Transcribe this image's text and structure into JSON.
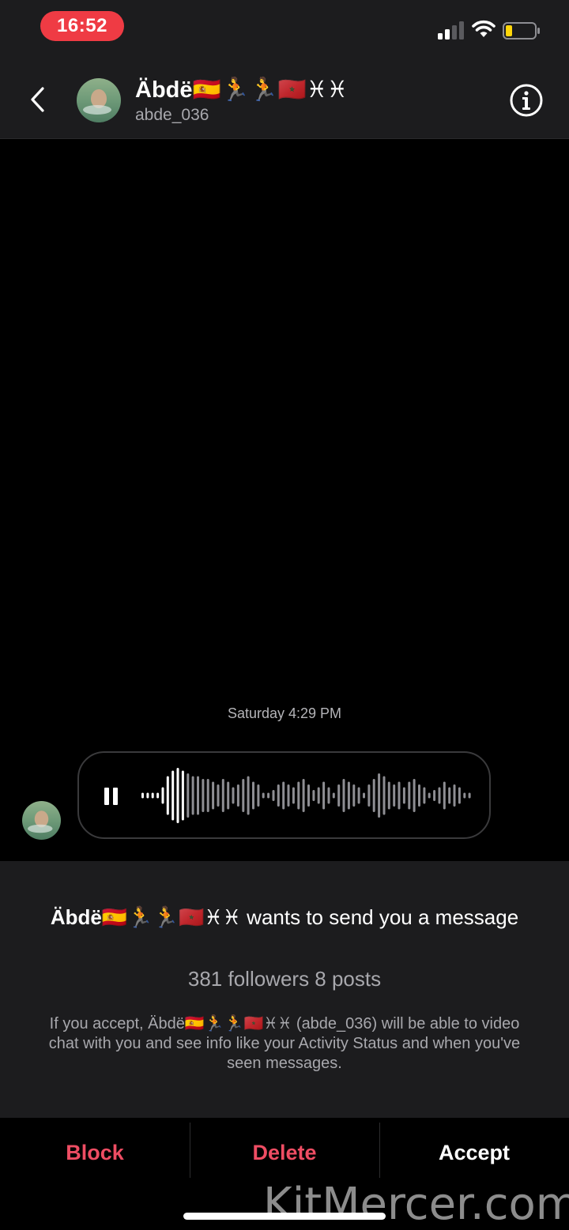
{
  "status_bar": {
    "time": "16:52",
    "time_pill_color": "#ef3b44",
    "signal_icon": "cellular-signal-icon",
    "wifi_icon": "wifi-icon",
    "battery_icon": "battery-low-icon",
    "battery_color": "#ffd60a"
  },
  "header": {
    "back_icon": "chevron-left-icon",
    "display_name": "Äbdë🇪🇸🏃🏃🇲🇦♓♓",
    "username": "abde_036",
    "info_icon": "info-icon"
  },
  "chat": {
    "timestamp": "Saturday 4:29 PM",
    "voice_message": {
      "state": "playing",
      "control_icon": "pause-icon",
      "progress": 0.07
    }
  },
  "request": {
    "sender_name": "Äbdë🇪🇸🏃🏃🇲🇦♓♓",
    "title_suffix": " wants to send you a message",
    "stats": "381 followers 8 posts",
    "note": "If you accept, Äbdë🇪🇸🏃🏃🇲🇦♓♓ (abde_036) will be able to video chat with you and see info like your Activity Status and when you've seen messages."
  },
  "actions": {
    "block_label": "Block",
    "delete_label": "Delete",
    "accept_label": "Accept",
    "destructive_color": "#ee4d63"
  },
  "watermark": "KitMercer.com"
}
